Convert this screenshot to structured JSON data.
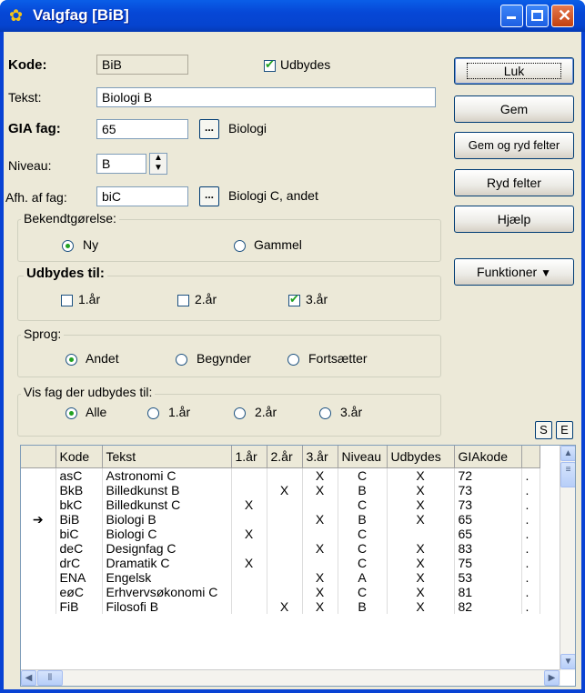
{
  "title": "Valgfag [BiB]",
  "kode": {
    "label": "Kode:",
    "value": "BiB"
  },
  "udbydes": {
    "label": "Udbydes",
    "checked": true
  },
  "tekst": {
    "label": "Tekst:",
    "value": "Biologi B"
  },
  "gia": {
    "label": "GIA fag:",
    "value": "65",
    "desc": "Biologi",
    "btn": "..."
  },
  "niveau": {
    "label": "Niveau:",
    "value": "B"
  },
  "afh": {
    "label": "Afh. af fag:",
    "value": "biC",
    "desc": "Biologi C, andet",
    "btn": "..."
  },
  "bekendt": {
    "legend": "Bekendtgørelse:",
    "opts": [
      "Ny",
      "Gammel"
    ]
  },
  "udbydes_til": {
    "legend": "Udbydes til:",
    "opts": [
      "1.år",
      "2.år",
      "3.år"
    ]
  },
  "sprog": {
    "legend": "Sprog:",
    "opts": [
      "Andet",
      "Begynder",
      "Fortsætter"
    ]
  },
  "vis": {
    "legend": "Vis fag der udbydes til:",
    "opts": [
      "Alle",
      "1.år",
      "2.år",
      "3.år"
    ]
  },
  "buttons": {
    "luk": "Luk",
    "gem": "Gem",
    "gem_ryd": "Gem og ryd felter",
    "ryd": "Ryd felter",
    "hjaelp": "Hjælp",
    "funktioner": "Funktioner"
  },
  "se": {
    "s": "S",
    "e": "E"
  },
  "table": {
    "headers": [
      "",
      "Kode",
      "Tekst",
      "1.år",
      "2.år",
      "3.år",
      "Niveau",
      "Udbydes",
      "GIAkode",
      ""
    ],
    "rows": [
      {
        "mark": "",
        "kode": "asC",
        "tekst": "Astronomi C",
        "a1": "",
        "a2": "",
        "a3": "X",
        "niv": "C",
        "udb": "X",
        "gia": "72",
        "x": "."
      },
      {
        "mark": "",
        "kode": "BkB",
        "tekst": "Billedkunst B",
        "a1": "",
        "a2": "X",
        "a3": "X",
        "niv": "B",
        "udb": "X",
        "gia": "73",
        "x": "."
      },
      {
        "mark": "",
        "kode": "bkC",
        "tekst": "Billedkunst C",
        "a1": "X",
        "a2": "",
        "a3": "",
        "niv": "C",
        "udb": "X",
        "gia": "73",
        "x": "."
      },
      {
        "mark": "➔",
        "kode": "BiB",
        "tekst": "Biologi B",
        "a1": "",
        "a2": "",
        "a3": "X",
        "niv": "B",
        "udb": "X",
        "gia": "65",
        "x": "."
      },
      {
        "mark": "",
        "kode": "biC",
        "tekst": "Biologi C",
        "a1": "X",
        "a2": "",
        "a3": "",
        "niv": "C",
        "udb": "",
        "gia": "65",
        "x": "."
      },
      {
        "mark": "",
        "kode": "deC",
        "tekst": "Designfag C",
        "a1": "",
        "a2": "",
        "a3": "X",
        "niv": "C",
        "udb": "X",
        "gia": "83",
        "x": "."
      },
      {
        "mark": "",
        "kode": "drC",
        "tekst": "Dramatik C",
        "a1": "X",
        "a2": "",
        "a3": "",
        "niv": "C",
        "udb": "X",
        "gia": "75",
        "x": "."
      },
      {
        "mark": "",
        "kode": "ENA",
        "tekst": "Engelsk",
        "a1": "",
        "a2": "",
        "a3": "X",
        "niv": "A",
        "udb": "X",
        "gia": "53",
        "x": "."
      },
      {
        "mark": "",
        "kode": "eøC",
        "tekst": "Erhvervsøkonomi C",
        "a1": "",
        "a2": "",
        "a3": "X",
        "niv": "C",
        "udb": "X",
        "gia": "81",
        "x": "."
      },
      {
        "mark": "",
        "kode": "FiB",
        "tekst": "Filosofi B",
        "a1": "",
        "a2": "X",
        "a3": "X",
        "niv": "B",
        "udb": "X",
        "gia": "82",
        "x": "."
      }
    ]
  }
}
